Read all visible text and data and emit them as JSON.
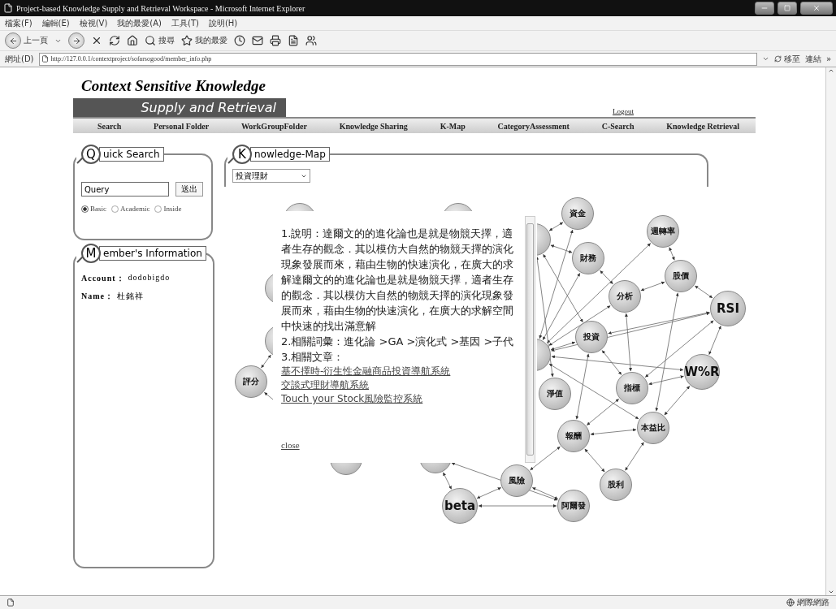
{
  "window": {
    "title": "Project-based Knowledge Supply and Retrieval Workspace - Microsoft Internet Explorer"
  },
  "menu": [
    "檔案(F)",
    "編輯(E)",
    "檢視(V)",
    "我的最愛(A)",
    "工具(T)",
    "說明(H)"
  ],
  "toolbar": {
    "back": "上一頁",
    "search": "搜尋",
    "favorites": "我的最愛"
  },
  "address": {
    "label": "網址(D)",
    "url": "http://127.0.0.1/contextproject/sofarsogood/member_info.php",
    "go": "移至",
    "links": "連結",
    "more": "»"
  },
  "site": {
    "logo_top": "Context Sensitive Knowledge",
    "logo_bottom": "Supply and Retrieval",
    "logout": "Logout",
    "nav": [
      "Search",
      "Personal Folder",
      "WorkGroupFolder",
      "Knowledge Sharing",
      "K-Map",
      "CategoryAssessment",
      "C-Search",
      "Knowledge Retrieval"
    ]
  },
  "quick_search": {
    "badge_letter": "Q",
    "title": "uick Search",
    "query": "Query",
    "submit": "送出",
    "modes": [
      {
        "label": "Basic",
        "selected": true
      },
      {
        "label": "Academic",
        "selected": false
      },
      {
        "label": "Inside",
        "selected": false
      }
    ]
  },
  "member": {
    "badge_letter": "M",
    "title": "ember's Information",
    "fields": [
      {
        "label": "Account：",
        "value": "dodobigdo"
      },
      {
        "label": "Name：",
        "value": "杜銘祥"
      }
    ]
  },
  "knowledge_map": {
    "badge_letter": "K",
    "title": "nowledge-Map",
    "category": "投資理財",
    "nodes": [
      {
        "kind": "small",
        "label": "資金"
      },
      {
        "kind": "small",
        "label": "週轉率"
      },
      {
        "kind": "small",
        "label": "財務"
      },
      {
        "kind": "small",
        "label": "股價"
      },
      {
        "kind": "small",
        "label": "分析"
      },
      {
        "kind": "big",
        "label": "RSI"
      },
      {
        "kind": "small",
        "label": "投資"
      },
      {
        "kind": "big",
        "label": "W%R"
      },
      {
        "kind": "small",
        "label": "指標"
      },
      {
        "kind": "small",
        "label": "淨值"
      },
      {
        "kind": "small",
        "label": "本益比"
      },
      {
        "kind": "small",
        "label": "報酬"
      },
      {
        "kind": "small",
        "label": "股利"
      },
      {
        "kind": "small",
        "label": "風險"
      },
      {
        "kind": "big",
        "label": "beta"
      },
      {
        "kind": "small",
        "label": "阿爾發"
      },
      {
        "kind": "small",
        "label": "評分"
      },
      {
        "kind": "covered"
      },
      {
        "kind": "covered"
      },
      {
        "kind": "covered"
      },
      {
        "kind": "covered"
      },
      {
        "kind": "covered"
      },
      {
        "kind": "covered"
      },
      {
        "kind": "covered"
      },
      {
        "kind": "covered"
      }
    ],
    "popup": {
      "paragraphs": [
        "1.說明：達爾文的的進化論也是就是物競天擇，適者生存的觀念．其以模仿大自然的物競天擇的演化現象發展而來，藉由生物的快速演化，在廣大的求解達爾文的的進化論也是就是物競天擇，適者生存的觀念．其以模仿大自然的物競天擇的演化現象發展而來，藉由生物的快速演化，在廣大的求解空間中快速的找出滿意解",
        "2.相關詞彙：進化論 >GA >演化式 >基因 >子代",
        "3.相關文章："
      ],
      "articles": [
        "基不擇時-衍生性金融商品投資導航系統",
        "交談式理財導航系統",
        "Touch your Stock風險監控系統"
      ],
      "close": "close"
    }
  },
  "status_bar": {
    "zone": "網際網路"
  }
}
